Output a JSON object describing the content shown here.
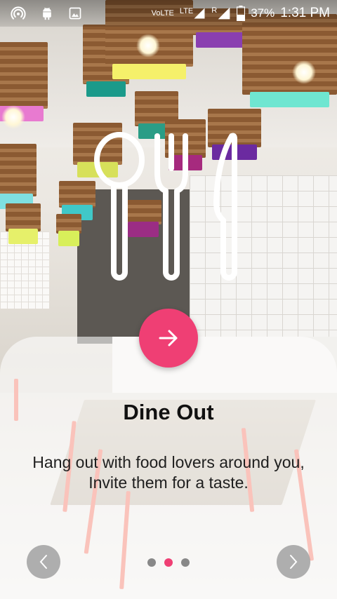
{
  "status_bar": {
    "icons": [
      "hotspot-icon",
      "android-icon",
      "image-icon"
    ],
    "volte": "VoLTE",
    "lte": "LTE",
    "roaming": "R",
    "battery": "37%",
    "time": "1:31 PM"
  },
  "onboarding": {
    "title": "Dine Out",
    "description": "Hang out with food lovers around you, Invite them for a taste.",
    "total_pages": 3,
    "current_page": 2,
    "accent_color": "#ef3f74"
  },
  "buttons": {
    "next_icon": "arrow-right-icon",
    "prev_icon": "chevron-left-icon",
    "forward_icon": "chevron-right-icon"
  }
}
